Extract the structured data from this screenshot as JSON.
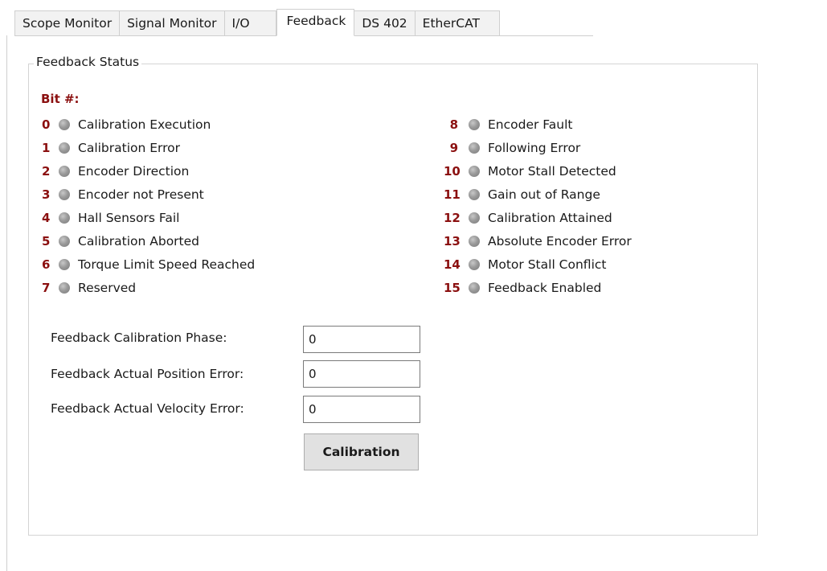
{
  "tabs": [
    {
      "label": "Scope Monitor"
    },
    {
      "label": "Signal Monitor"
    },
    {
      "label": "I/O"
    },
    {
      "label": "Feedback"
    },
    {
      "label": "DS 402"
    },
    {
      "label": "EtherCAT"
    }
  ],
  "active_tab": "Feedback",
  "group": {
    "title": "Feedback Status",
    "bit_header": "Bit #:"
  },
  "bits_left": [
    {
      "num": "0",
      "label": "Calibration Execution"
    },
    {
      "num": "1",
      "label": "Calibration Error"
    },
    {
      "num": "2",
      "label": "Encoder Direction"
    },
    {
      "num": "3",
      "label": "Encoder not Present"
    },
    {
      "num": "4",
      "label": "Hall Sensors Fail"
    },
    {
      "num": "5",
      "label": "Calibration Aborted"
    },
    {
      "num": "6",
      "label": "Torque Limit Speed Reached"
    },
    {
      "num": "7",
      "label": "Reserved"
    }
  ],
  "bits_right": [
    {
      "num": "8",
      "label": "Encoder Fault"
    },
    {
      "num": "9",
      "label": "Following Error"
    },
    {
      "num": "10",
      "label": "Motor Stall Detected"
    },
    {
      "num": "11",
      "label": "Gain out of Range"
    },
    {
      "num": "12",
      "label": "Calibration Attained"
    },
    {
      "num": "13",
      "label": "Absolute Encoder Error"
    },
    {
      "num": "14",
      "label": "Motor Stall Conflict"
    },
    {
      "num": "15",
      "label": "Feedback Enabled"
    }
  ],
  "fields": [
    {
      "label": "Feedback Calibration Phase:",
      "value": "0"
    },
    {
      "label": "Feedback Actual Position Error:",
      "value": "0"
    },
    {
      "label": "Feedback Actual Velocity Error:",
      "value": "0"
    }
  ],
  "calibration_button": "Calibration",
  "colors": {
    "bit_number": "#8b1010",
    "led_off": "#9a9a9a",
    "button_bg": "#e1e1e1"
  },
  "icons": {
    "led": "status-led-icon"
  }
}
